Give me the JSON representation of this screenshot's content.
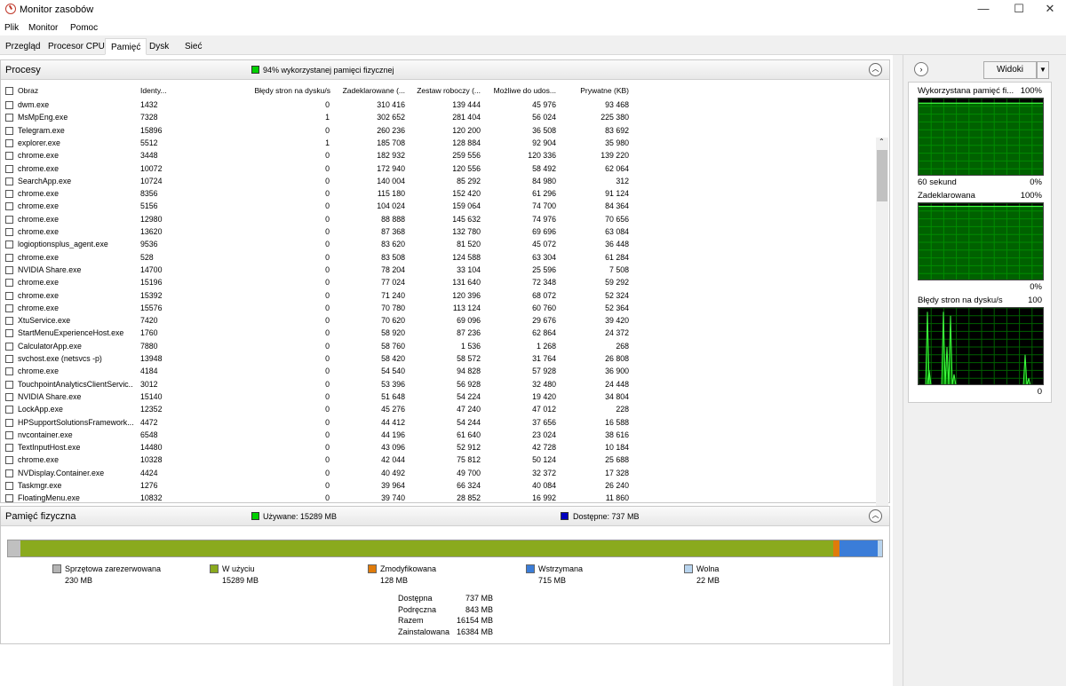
{
  "window": {
    "title": "Monitor zasobów",
    "minimize": "—",
    "maximize": "☐",
    "close": "✕"
  },
  "menu": [
    "Plik",
    "Monitor",
    "Pomoc"
  ],
  "tabs": [
    "Przegląd",
    "Procesor CPU",
    "Pamięć",
    "Dysk",
    "Sieć"
  ],
  "processes": {
    "title": "Procesy",
    "usage_label": "94% wykorzystanej pamięci fizycznej",
    "usage_color": "#00d000",
    "columns": [
      "Obraz",
      "Identy...",
      "Błędy stron na dysku/s",
      "Zadeklarowane (...",
      "Zestaw roboczy (...",
      "Możliwe do udos...",
      "Prywatne (KB)"
    ],
    "rows": [
      [
        "dwm.exe",
        "1432",
        "0",
        "310 416",
        "139 444",
        "45 976",
        "93 468"
      ],
      [
        "MsMpEng.exe",
        "7328",
        "1",
        "302 652",
        "281 404",
        "56 024",
        "225 380"
      ],
      [
        "Telegram.exe",
        "15896",
        "0",
        "260 236",
        "120 200",
        "36 508",
        "83 692"
      ],
      [
        "explorer.exe",
        "5512",
        "1",
        "185 708",
        "128 884",
        "92 904",
        "35 980"
      ],
      [
        "chrome.exe",
        "3448",
        "0",
        "182 932",
        "259 556",
        "120 336",
        "139 220"
      ],
      [
        "chrome.exe",
        "10072",
        "0",
        "172 940",
        "120 556",
        "58 492",
        "62 064"
      ],
      [
        "SearchApp.exe",
        "10724",
        "0",
        "140 004",
        "85 292",
        "84 980",
        "312"
      ],
      [
        "chrome.exe",
        "8356",
        "0",
        "115 180",
        "152 420",
        "61 296",
        "91 124"
      ],
      [
        "chrome.exe",
        "5156",
        "0",
        "104 024",
        "159 064",
        "74 700",
        "84 364"
      ],
      [
        "chrome.exe",
        "12980",
        "0",
        "88 888",
        "145 632",
        "74 976",
        "70 656"
      ],
      [
        "chrome.exe",
        "13620",
        "0",
        "87 368",
        "132 780",
        "69 696",
        "63 084"
      ],
      [
        "logioptionsplus_agent.exe",
        "9536",
        "0",
        "83 620",
        "81 520",
        "45 072",
        "36 448"
      ],
      [
        "chrome.exe",
        "528",
        "0",
        "83 508",
        "124 588",
        "63 304",
        "61 284"
      ],
      [
        "NVIDIA Share.exe",
        "14700",
        "0",
        "78 204",
        "33 104",
        "25 596",
        "7 508"
      ],
      [
        "chrome.exe",
        "15196",
        "0",
        "77 024",
        "131 640",
        "72 348",
        "59 292"
      ],
      [
        "chrome.exe",
        "15392",
        "0",
        "71 240",
        "120 396",
        "68 072",
        "52 324"
      ],
      [
        "chrome.exe",
        "15576",
        "0",
        "70 780",
        "113 124",
        "60 760",
        "52 364"
      ],
      [
        "XtuService.exe",
        "7420",
        "0",
        "70 620",
        "69 096",
        "29 676",
        "39 420"
      ],
      [
        "StartMenuExperienceHost.exe",
        "1760",
        "0",
        "58 920",
        "87 236",
        "62 864",
        "24 372"
      ],
      [
        "CalculatorApp.exe",
        "7880",
        "0",
        "58 760",
        "1 536",
        "1 268",
        "268"
      ],
      [
        "svchost.exe (netsvcs -p)",
        "13948",
        "0",
        "58 420",
        "58 572",
        "31 764",
        "26 808"
      ],
      [
        "chrome.exe",
        "4184",
        "0",
        "54 540",
        "94 828",
        "57 928",
        "36 900"
      ],
      [
        "TouchpointAnalyticsClientServic...",
        "3012",
        "0",
        "53 396",
        "56 928",
        "32 480",
        "24 448"
      ],
      [
        "NVIDIA Share.exe",
        "15140",
        "0",
        "51 648",
        "54 224",
        "19 420",
        "34 804"
      ],
      [
        "LockApp.exe",
        "12352",
        "0",
        "45 276",
        "47 240",
        "47 012",
        "228"
      ],
      [
        "HPSupportSolutionsFramework...",
        "4472",
        "0",
        "44 412",
        "54 244",
        "37 656",
        "16 588"
      ],
      [
        "nvcontainer.exe",
        "6548",
        "0",
        "44 196",
        "61 640",
        "23 024",
        "38 616"
      ],
      [
        "TextInputHost.exe",
        "14480",
        "0",
        "43 096",
        "52 912",
        "42 728",
        "10 184"
      ],
      [
        "chrome.exe",
        "10328",
        "0",
        "42 044",
        "75 812",
        "50 124",
        "25 688"
      ],
      [
        "NVDisplay.Container.exe",
        "4424",
        "0",
        "40 492",
        "49 700",
        "32 372",
        "17 328"
      ],
      [
        "Taskmgr.exe",
        "1276",
        "0",
        "39 964",
        "66 324",
        "40 084",
        "26 240"
      ],
      [
        "FloatingMenu.exe",
        "10832",
        "0",
        "39 740",
        "28 852",
        "16 992",
        "11 860"
      ]
    ]
  },
  "physical": {
    "title": "Pamięć fizyczna",
    "used_label": "Używane: 15289 MB",
    "used_color": "#00d000",
    "available_label": "Dostępne: 737 MB",
    "available_color": "#0000c0",
    "bar": [
      {
        "name": "hw",
        "value_mb": 230,
        "color": "#c0c0c0"
      },
      {
        "name": "inuse",
        "value_mb": 15289,
        "color": "#8aaa1e"
      },
      {
        "name": "modified",
        "value_mb": 128,
        "color": "#e07b0a"
      },
      {
        "name": "standby",
        "value_mb": 715,
        "color": "#3b7dd8"
      },
      {
        "name": "free",
        "value_mb": 22,
        "color": "#b8d4ee"
      }
    ],
    "legend": [
      {
        "name": "Sprzętowa zarezerwowana",
        "value": "230 MB",
        "color": "#b4b4b4"
      },
      {
        "name": "W użyciu",
        "value": "15289 MB",
        "color": "#8aaa1e"
      },
      {
        "name": "Zmodyfikowana",
        "value": "128 MB",
        "color": "#e07b0a"
      },
      {
        "name": "Wstrzymana",
        "value": "715 MB",
        "color": "#3b7dd8"
      },
      {
        "name": "Wolna",
        "value": "22 MB",
        "color": "#b8d4ee"
      }
    ],
    "summary": [
      {
        "name": "Dostępna",
        "value": "737 MB"
      },
      {
        "name": "Podręczna",
        "value": "843 MB"
      },
      {
        "name": "Razem",
        "value": "16154 MB"
      },
      {
        "name": "Zainstalowana",
        "value": "16384 MB"
      }
    ]
  },
  "right": {
    "views_button": "Widoki",
    "graphs": [
      {
        "title": "Wykorzystana pamięć fi...",
        "max": "100%",
        "left_bottom": "60 sekund",
        "right_bottom": "0%",
        "fill": 0.94
      },
      {
        "title": "Zadeklarowana",
        "max": "100%",
        "left_bottom": "",
        "right_bottom": "0%",
        "fill": 0.96
      },
      {
        "title": "Błędy stron na dysku/s",
        "max": "100",
        "left_bottom": "",
        "right_bottom": "0",
        "fill": 0
      }
    ],
    "graph_color": "#00b000",
    "grid_color": "#006000"
  }
}
